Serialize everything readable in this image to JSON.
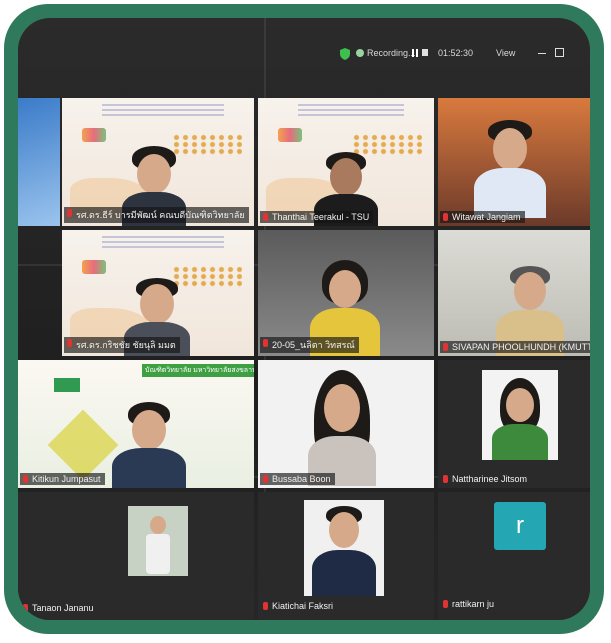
{
  "topbar": {
    "recording_label": "Recording...",
    "timer": "01:52:30",
    "view_label": "View"
  },
  "participants": [
    {
      "id": "p1",
      "name": "รศ.ดร.ธีร์ บารมีพัฒน์ คณบดีบัณฑิตวิทยาลัย"
    },
    {
      "id": "p2",
      "name": "Thanthai Teerakul - TSU"
    },
    {
      "id": "p3",
      "name": "Witawat Jangiam"
    },
    {
      "id": "p4",
      "name": "รศ.ดร.กริชชัย ชัยนุลิ มมต"
    },
    {
      "id": "p5",
      "name": "20-05_นลิตา วิทสรณ์"
    },
    {
      "id": "p6",
      "name": "SIVAPAN PHOOLHUNDH (KMUTT)"
    },
    {
      "id": "p7",
      "name": "Kitikun Jumpasut"
    },
    {
      "id": "p8",
      "name": "Bussaba Boon"
    },
    {
      "id": "p9",
      "name": "Nattharinee Jitsom"
    },
    {
      "id": "p10",
      "name": "Tanaon Jananu"
    },
    {
      "id": "p11",
      "name": "Kiatichai Faksri"
    },
    {
      "id": "p12",
      "name": "rattikarn ju",
      "avatar_letter": "r"
    }
  ],
  "banner_text": "บัณฑิตวิทยาลัย มหาวิทยาลัยสงขลานครินทร์",
  "colors": {
    "frame": "#2f7a5d",
    "mic_muted": "#e03434",
    "avatar": "#25a7b3"
  }
}
